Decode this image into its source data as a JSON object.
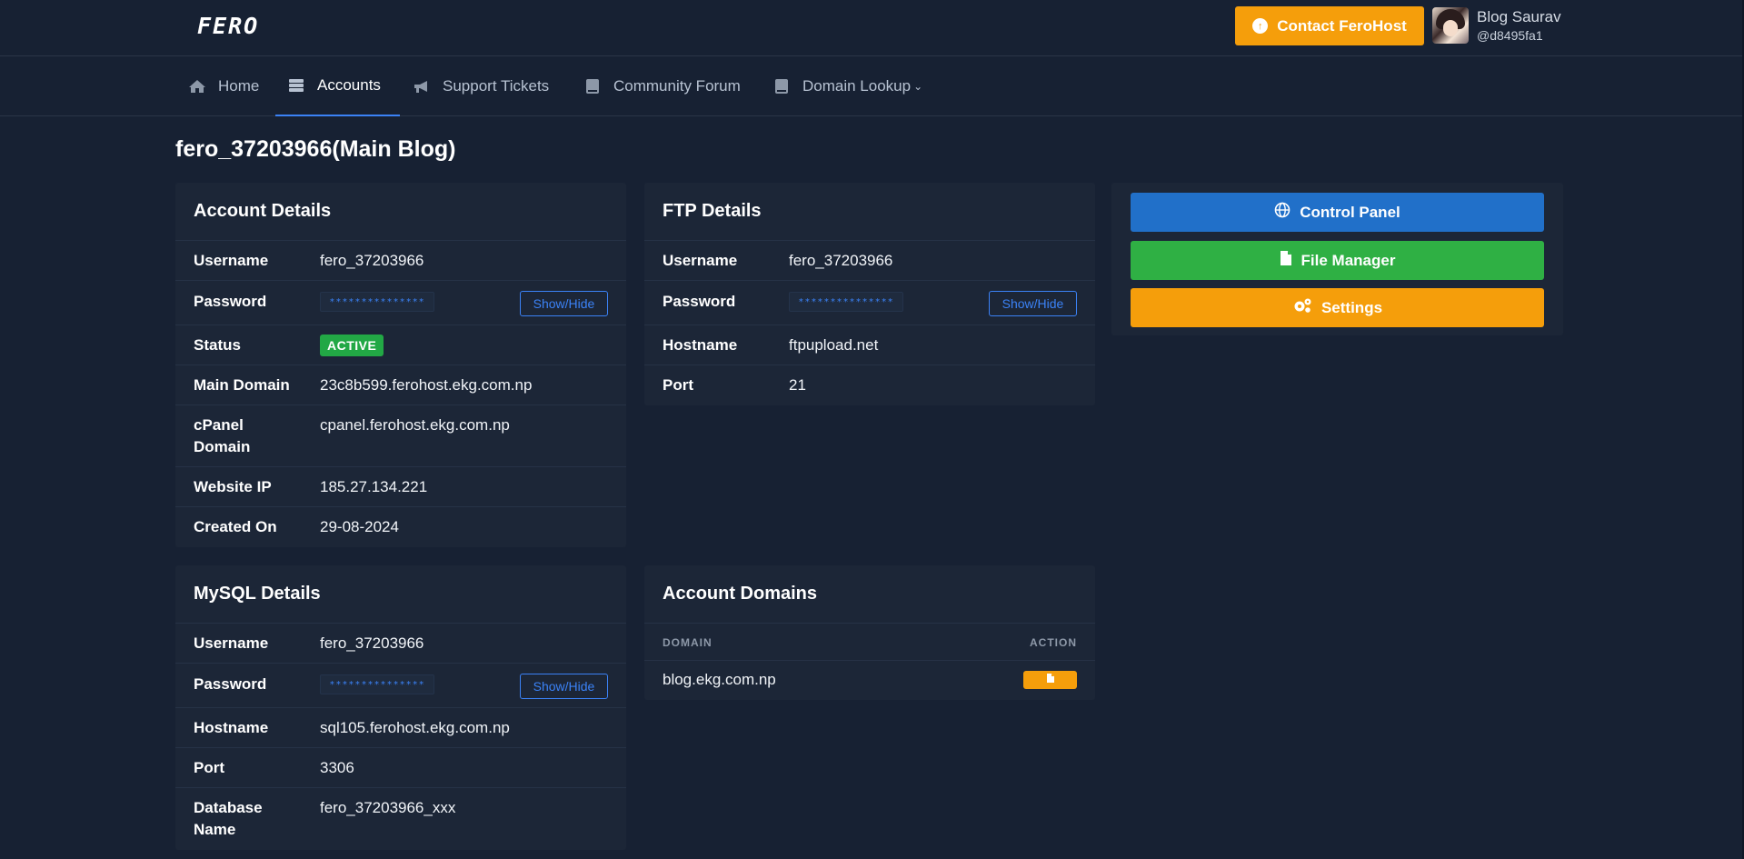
{
  "header": {
    "logo_text": "FERO",
    "contact_button": "Contact FeroHost",
    "user_name": "Blog Saurav",
    "user_handle": "@d8495fa1"
  },
  "nav": {
    "items": [
      {
        "label": "Home",
        "icon": "home-icon"
      },
      {
        "label": "Accounts",
        "icon": "server-icon",
        "active": true
      },
      {
        "label": "Support Tickets",
        "icon": "megaphone-icon"
      },
      {
        "label": "Community Forum",
        "icon": "book-icon"
      },
      {
        "label": "Domain Lookup",
        "icon": "book-icon",
        "dropdown": true
      }
    ]
  },
  "page": {
    "title": "fero_37203966(Main Blog)"
  },
  "account_details": {
    "title": "Account Details",
    "username_label": "Username",
    "username": "fero_37203966",
    "password_label": "Password",
    "password_mask": "***************",
    "show_hide": "Show/Hide",
    "status_label": "Status",
    "status": "ACTIVE",
    "main_domain_label": "Main Domain",
    "main_domain": "23c8b599.ferohost.ekg.com.np",
    "cpanel_domain_label_1": "cPanel",
    "cpanel_domain_label_2": "Domain",
    "cpanel_domain": "cpanel.ferohost.ekg.com.np",
    "website_ip_label": "Website IP",
    "website_ip": "185.27.134.221",
    "created_on_label": "Created On",
    "created_on": "29-08-2024"
  },
  "ftp_details": {
    "title": "FTP Details",
    "username_label": "Username",
    "username": "fero_37203966",
    "password_label": "Password",
    "password_mask": "***************",
    "show_hide": "Show/Hide",
    "hostname_label": "Hostname",
    "hostname": "ftpupload.net",
    "port_label": "Port",
    "port": "21"
  },
  "actions": {
    "control_panel": "Control Panel",
    "file_manager": "File Manager",
    "settings": "Settings",
    "colors": {
      "control_panel": "#2170c9",
      "file_manager": "#2fb044",
      "settings": "#f59e0b"
    }
  },
  "mysql_details": {
    "title": "MySQL Details",
    "username_label": "Username",
    "username": "fero_37203966",
    "password_label": "Password",
    "password_mask": "***************",
    "show_hide": "Show/Hide",
    "hostname_label": "Hostname",
    "hostname": "sql105.ferohost.ekg.com.np",
    "port_label": "Port",
    "port": "3306",
    "database_label_1": "Database",
    "database_label_2": "Name",
    "database_name": "fero_37203966_xxx"
  },
  "account_domains": {
    "title": "Account Domains",
    "col_domain": "DOMAIN",
    "col_action": "ACTION",
    "rows": [
      {
        "domain": "blog.ekg.com.np"
      }
    ]
  }
}
